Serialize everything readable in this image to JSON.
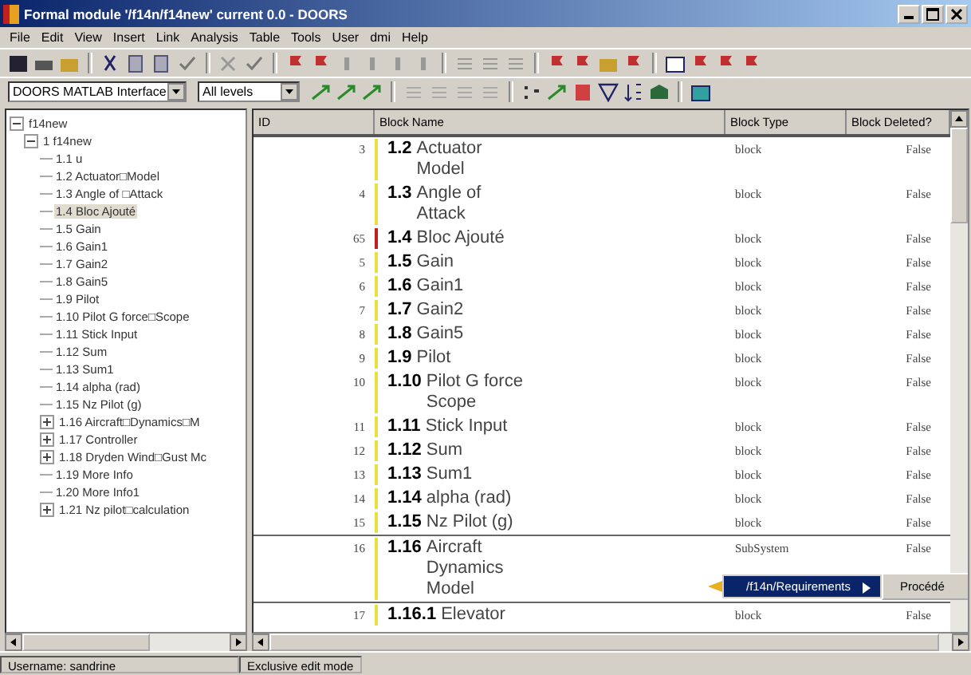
{
  "window": {
    "title": "Formal module '/f14n/f14new' current 0.0 - DOORS"
  },
  "menu": [
    "File",
    "Edit",
    "View",
    "Insert",
    "Link",
    "Analysis",
    "Table",
    "Tools",
    "User",
    "dmi",
    "Help"
  ],
  "toolbar": {
    "view_select": "DOORS MATLAB Interface",
    "level_select": "All levels"
  },
  "tree": [
    {
      "label": "f14new",
      "expanded": true,
      "children": [
        {
          "label": "1 f14new",
          "expanded": true,
          "children": [
            {
              "label": "1.1 u",
              "selected": false
            },
            {
              "label": "1.2 Actuator□Model",
              "selected": false
            },
            {
              "label": "1.3 Angle of □Attack",
              "selected": false
            },
            {
              "label": "1.4 Bloc Ajouté",
              "selected": true
            },
            {
              "label": "1.5 Gain",
              "selected": false
            },
            {
              "label": "1.6 Gain1",
              "selected": false
            },
            {
              "label": "1.7 Gain2",
              "selected": false
            },
            {
              "label": "1.8 Gain5",
              "selected": false
            },
            {
              "label": "1.9 Pilot",
              "selected": false
            },
            {
              "label": "1.10 Pilot G force□Scope",
              "selected": false
            },
            {
              "label": "1.11 Stick Input",
              "selected": false
            },
            {
              "label": "1.12 Sum",
              "selected": false
            },
            {
              "label": "1.13 Sum1",
              "selected": false
            },
            {
              "label": "1.14 alpha (rad)",
              "selected": false
            },
            {
              "label": "1.15 Nz Pilot (g)",
              "selected": false
            },
            {
              "label": "1.16 Aircraft□Dynamics□M",
              "selected": false,
              "expanded": false
            },
            {
              "label": "1.17 Controller",
              "selected": false,
              "expanded": false
            },
            {
              "label": "1.18 Dryden Wind□Gust Mc",
              "selected": false,
              "expanded": false
            },
            {
              "label": "1.19 More Info",
              "selected": false
            },
            {
              "label": "1.20 More Info1",
              "selected": false
            },
            {
              "label": "1.21 Nz pilot□calculation",
              "selected": false,
              "expanded": false
            }
          ]
        }
      ]
    }
  ],
  "table": {
    "columns": [
      "ID",
      "Block Name",
      "Block Type",
      "Block Deleted?"
    ],
    "rows": [
      {
        "id": "3",
        "number": "1.2",
        "name": [
          "Actuator",
          "Model"
        ],
        "type": "block",
        "deleted": "False",
        "color": "#e8e040"
      },
      {
        "id": "4",
        "number": "1.3",
        "name": [
          "Angle of",
          "Attack"
        ],
        "type": "block",
        "deleted": "False",
        "color": "#e8e040"
      },
      {
        "id": "65",
        "number": "1.4",
        "name": [
          "Bloc Ajouté"
        ],
        "type": "block",
        "deleted": "False",
        "color": "#c02020"
      },
      {
        "id": "5",
        "number": "1.5",
        "name": [
          "Gain"
        ],
        "type": "block",
        "deleted": "False",
        "color": "#e8e040"
      },
      {
        "id": "6",
        "number": "1.6",
        "name": [
          "Gain1"
        ],
        "type": "block",
        "deleted": "False",
        "color": "#e8e040"
      },
      {
        "id": "7",
        "number": "1.7",
        "name": [
          "Gain2"
        ],
        "type": "block",
        "deleted": "False",
        "color": "#e8e040"
      },
      {
        "id": "8",
        "number": "1.8",
        "name": [
          "Gain5"
        ],
        "type": "block",
        "deleted": "False",
        "color": "#e8e040"
      },
      {
        "id": "9",
        "number": "1.9",
        "name": [
          "Pilot"
        ],
        "type": "block",
        "deleted": "False",
        "color": "#e8e040"
      },
      {
        "id": "10",
        "number": "1.10",
        "name": [
          "Pilot G force",
          "Scope"
        ],
        "type": "block",
        "deleted": "False",
        "color": "#e8e040"
      },
      {
        "id": "11",
        "number": "1.11",
        "name": [
          "Stick Input"
        ],
        "type": "block",
        "deleted": "False",
        "color": "#e8e040"
      },
      {
        "id": "12",
        "number": "1.12",
        "name": [
          "Sum"
        ],
        "type": "block",
        "deleted": "False",
        "color": "#e8e040"
      },
      {
        "id": "13",
        "number": "1.13",
        "name": [
          "Sum1"
        ],
        "type": "block",
        "deleted": "False",
        "color": "#e8e040"
      },
      {
        "id": "14",
        "number": "1.14",
        "name": [
          "alpha (rad)"
        ],
        "type": "block",
        "deleted": "False",
        "color": "#e8e040"
      },
      {
        "id": "15",
        "number": "1.15",
        "name": [
          "Nz Pilot (g)"
        ],
        "type": "block",
        "deleted": "False",
        "color": "#e8e040"
      },
      {
        "id": "16",
        "number": "1.16",
        "name": [
          "Aircraft",
          "Dynamics",
          "Model"
        ],
        "type": "SubSystem",
        "deleted": "False",
        "color": "#e8e040"
      },
      {
        "id": "17",
        "number": "1.16.1",
        "name": [
          "Elevator"
        ],
        "type": "block",
        "deleted": "False",
        "color": "#e8e040"
      }
    ]
  },
  "popup": {
    "item": "/f14n/Requirements",
    "submenu": "Procédé"
  },
  "status_bar": [
    "Username: sandrine",
    "Exclusive edit mode"
  ]
}
